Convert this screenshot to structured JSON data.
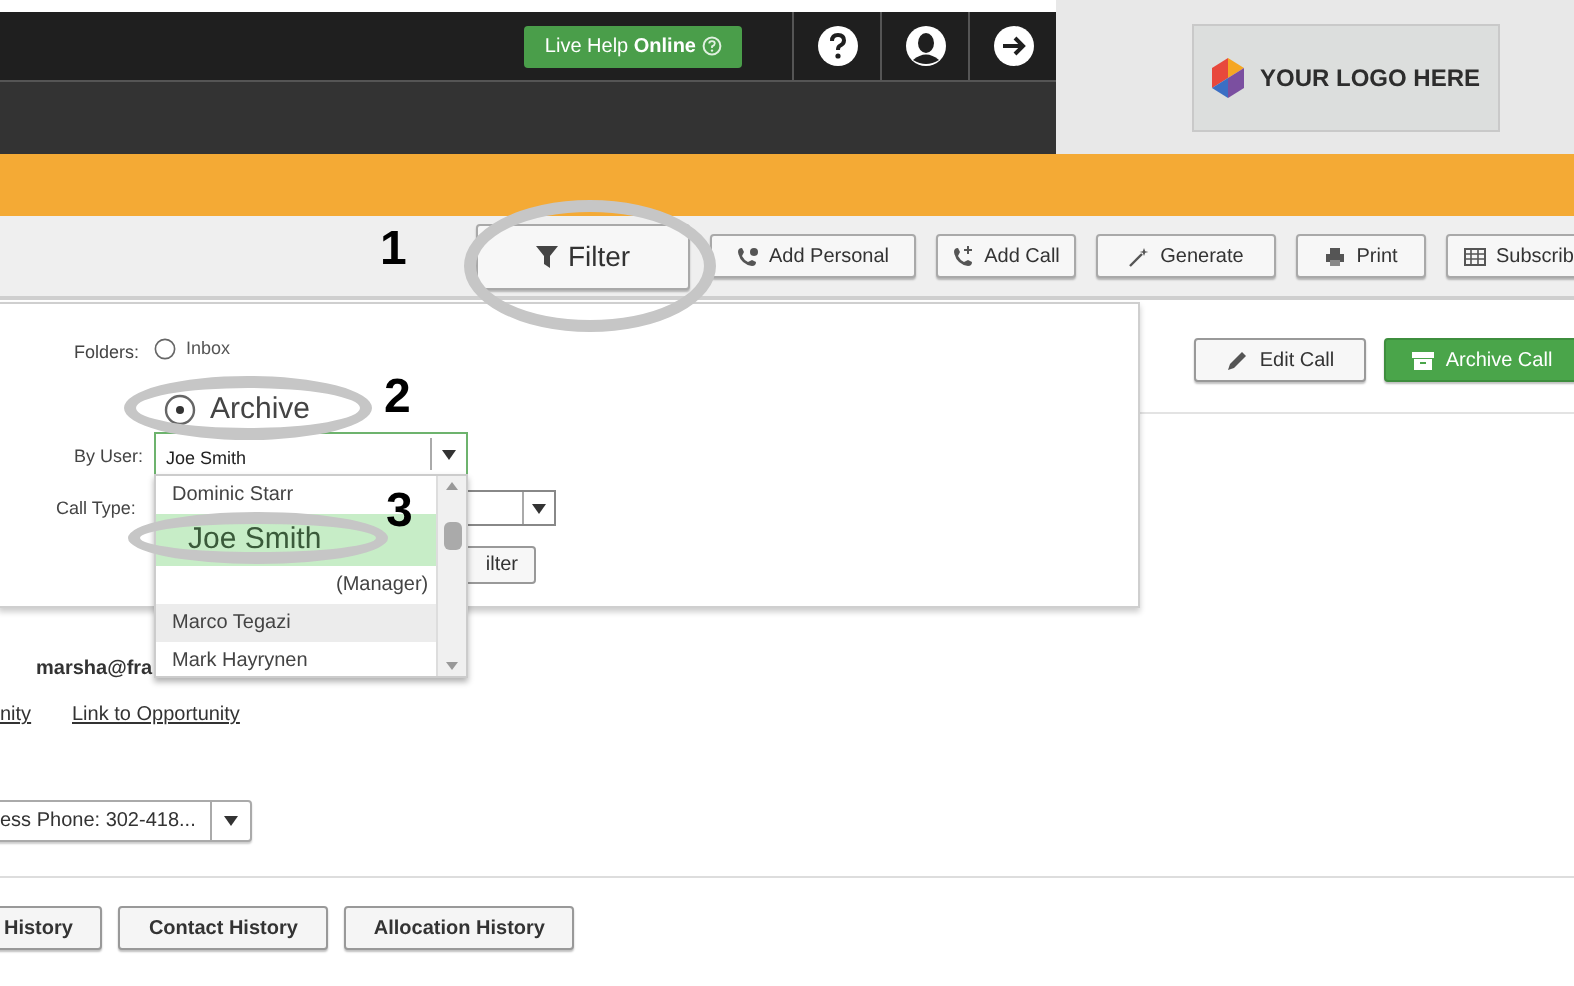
{
  "header": {
    "live_help": "Live Help **Online**"
  },
  "logo": {
    "text": "YOUR LOGO HERE"
  },
  "toolbar": {
    "buttons": [
      {
        "label": "Filter",
        "kind": "filter"
      },
      {
        "label": "Add Personal",
        "kind": "add-personal"
      },
      {
        "label": "Add Call",
        "kind": "add-call"
      },
      {
        "label": "Generate",
        "kind": "generate"
      },
      {
        "label": "Print",
        "kind": "print"
      },
      {
        "label": "Subscrib",
        "kind": "subscribe"
      }
    ]
  },
  "filter_panel": {
    "folders_label": "Folders:",
    "folders": [
      {
        "label": "Inbox",
        "selected": false
      },
      {
        "label": "Archive",
        "selected": true
      }
    ],
    "by_user": {
      "label": "By User:",
      "value": "Joe Smith"
    },
    "user_options": [
      {
        "label": "Dominic Starr",
        "selected": false,
        "hovered": false
      },
      {
        "label": "Joe Smith",
        "selected": true,
        "hovered": false
      },
      {
        "label": "(Manager)",
        "selected": false,
        "hovered": false
      },
      {
        "label": "Marco Tegazi",
        "selected": false,
        "hovered": true
      },
      {
        "label": "Mark Hayrynen",
        "selected": false,
        "hovered": false
      }
    ],
    "call_type": {
      "label": "Call Type:"
    },
    "filter_button": "ilter"
  },
  "callouts": [
    {
      "number": "1"
    },
    {
      "number": "2"
    },
    {
      "number": "3"
    }
  ],
  "actions": [
    {
      "label": "Edit Call",
      "kind": "edit"
    },
    {
      "label": "Archive Call",
      "kind": "archive"
    }
  ],
  "contact": {
    "email": "marsha@fra",
    "links": [
      "nity",
      "Link to Opportunity"
    ],
    "phone_select": {
      "value": "ess Phone: 302-418..."
    }
  },
  "history_buttons": [
    "History",
    "Contact History",
    "Allocation History"
  ]
}
